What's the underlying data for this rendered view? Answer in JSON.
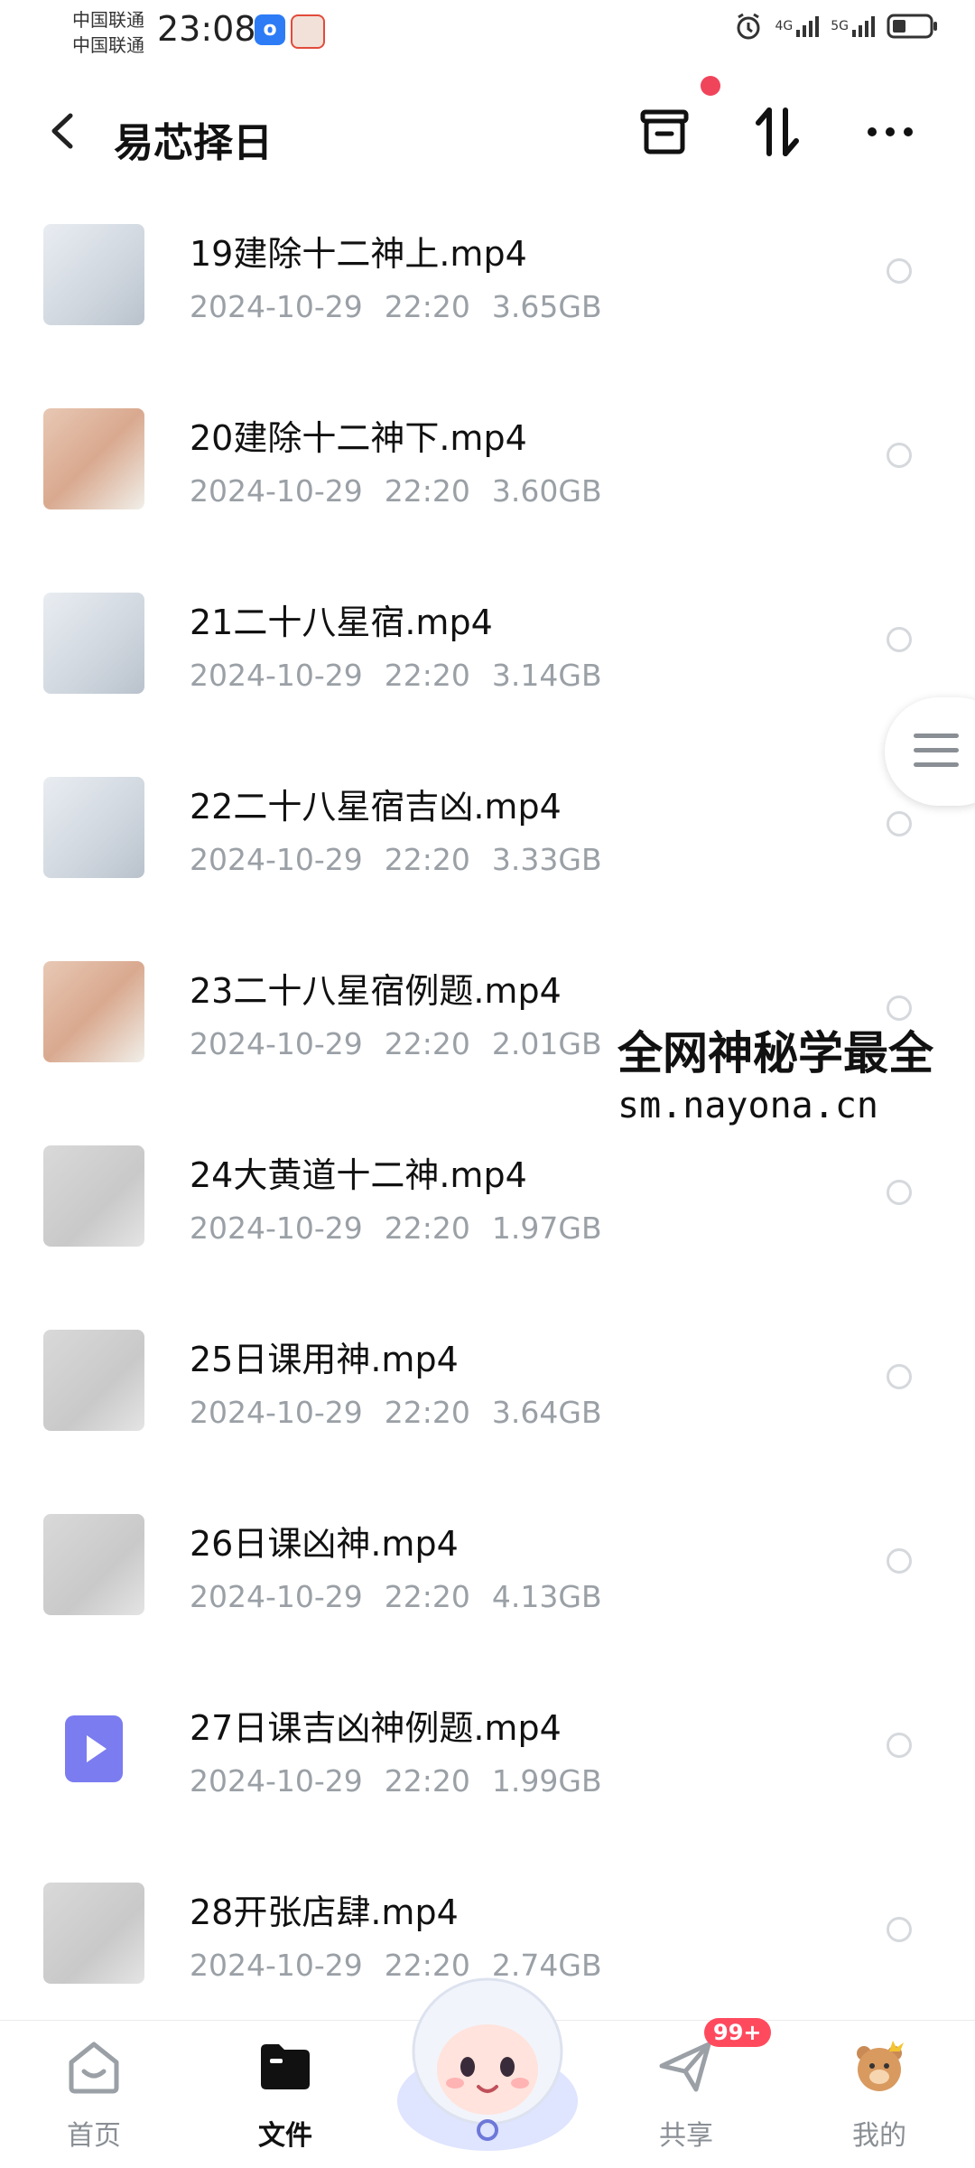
{
  "status_bar": {
    "carrier_1": "中国联通",
    "carrier_2": "中国联通",
    "time": "23:08",
    "net_1": "4G",
    "net_2": "5G"
  },
  "header": {
    "title": "易芯择日"
  },
  "files": [
    {
      "name": "19建除十二神上.mp4",
      "date": "2024-10-29",
      "time": "22:20",
      "size": "3.65GB",
      "thumb": "doc"
    },
    {
      "name": "20建除十二神下.mp4",
      "date": "2024-10-29",
      "time": "22:20",
      "size": "3.60GB",
      "thumb": "hand"
    },
    {
      "name": "21二十八星宿.mp4",
      "date": "2024-10-29",
      "time": "22:20",
      "size": "3.14GB",
      "thumb": "doc"
    },
    {
      "name": "22二十八星宿吉凶.mp4",
      "date": "2024-10-29",
      "time": "22:20",
      "size": "3.33GB",
      "thumb": "doc"
    },
    {
      "name": "23二十八星宿例题.mp4",
      "date": "2024-10-29",
      "time": "22:20",
      "size": "2.01GB",
      "thumb": "hand"
    },
    {
      "name": "24大黄道十二神.mp4",
      "date": "2024-10-29",
      "time": "22:20",
      "size": "1.97GB",
      "thumb": "paper"
    },
    {
      "name": "25日课用神.mp4",
      "date": "2024-10-29",
      "time": "22:20",
      "size": "3.64GB",
      "thumb": "paper"
    },
    {
      "name": "26日课凶神.mp4",
      "date": "2024-10-29",
      "time": "22:20",
      "size": "4.13GB",
      "thumb": "paper"
    },
    {
      "name": "27日课吉凶神例题.mp4",
      "date": "2024-10-29",
      "time": "22:20",
      "size": "1.99GB",
      "thumb": "video-icon"
    },
    {
      "name": "28开张店肆.mp4",
      "date": "2024-10-29",
      "time": "22:20",
      "size": "2.74GB",
      "thumb": "paper"
    }
  ],
  "watermark": {
    "line1": "全网神秘学最全",
    "line2": "sm.nayona.cn"
  },
  "tabbar": {
    "home": "首页",
    "files": "文件",
    "share": "共享",
    "share_badge": "99+",
    "mine": "我的"
  },
  "colors": {
    "accent_red": "#f0445b",
    "video_icon": "#7b7cf0",
    "meta_gray": "#9aa0a6"
  }
}
